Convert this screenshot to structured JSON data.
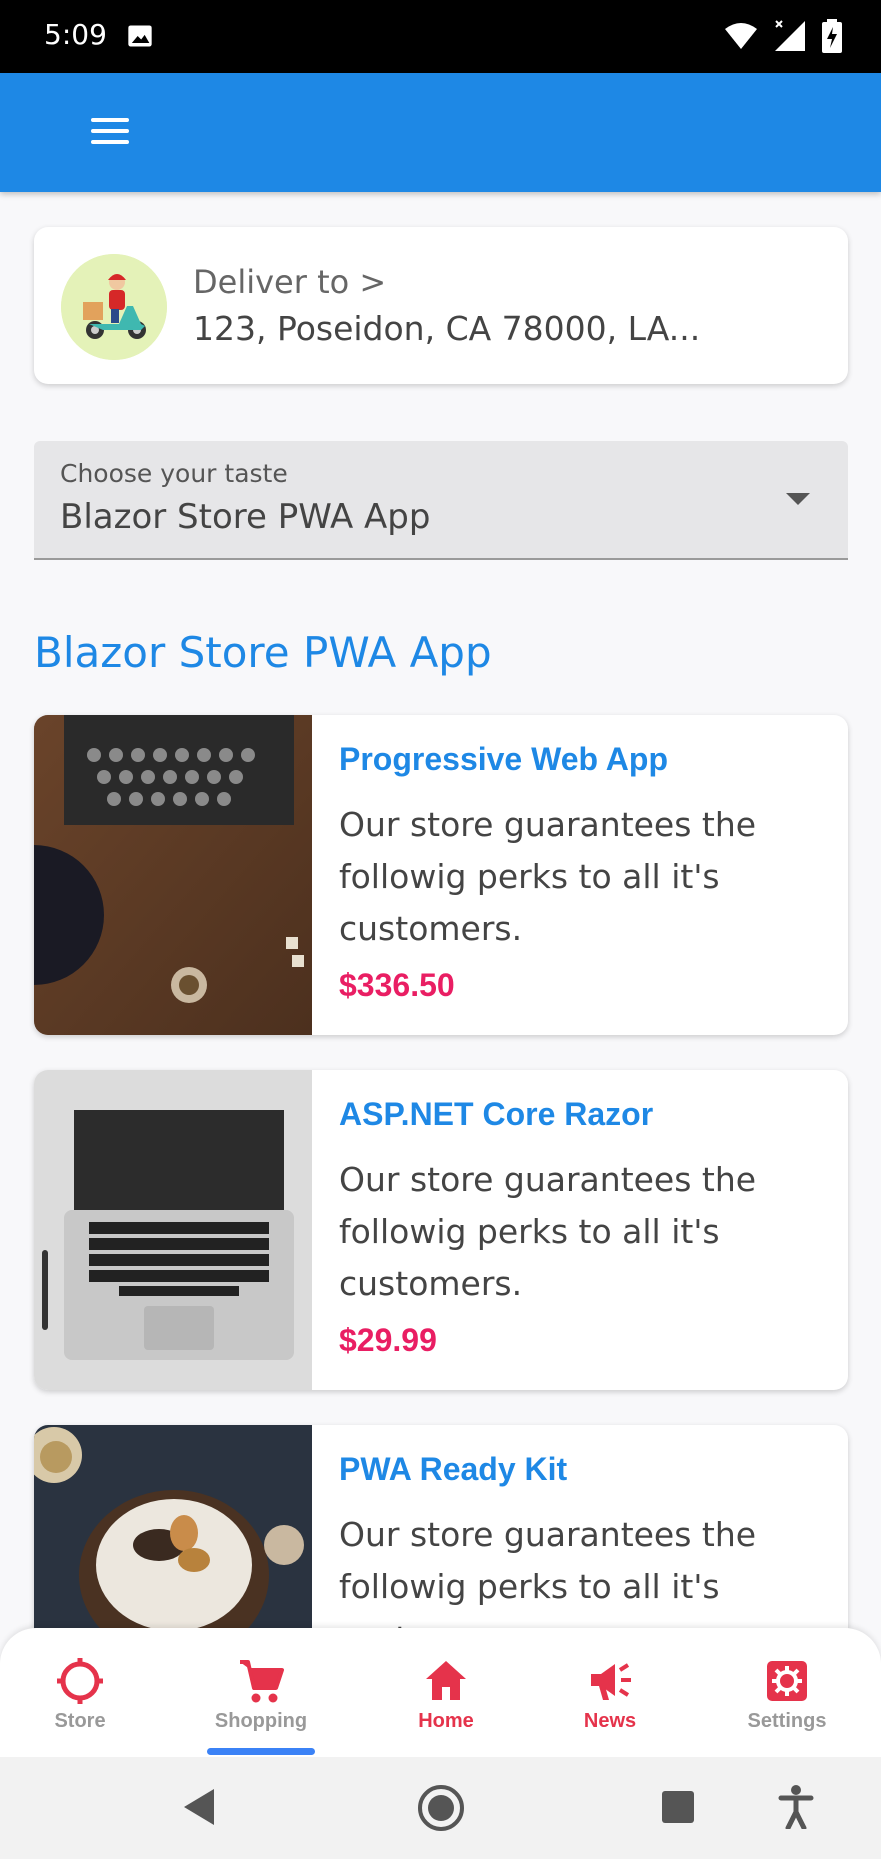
{
  "status_bar": {
    "time": "5:09",
    "icons": [
      "image-icon",
      "wifi-icon",
      "signal-icon",
      "battery-charging-icon"
    ]
  },
  "app_bar": {
    "menu_icon": "hamburger-menu-icon",
    "color": "#1e88e5"
  },
  "delivery": {
    "label": "Deliver to >",
    "address": "123, Poseidon, CA 78000, LA..."
  },
  "taste_select": {
    "label": "Choose your taste",
    "value": "Blazor Store PWA App"
  },
  "section_title": "Blazor Store PWA App",
  "products": [
    {
      "title": "Progressive Web App",
      "description": "Our store guarantees the followig perks to all it's customers.",
      "price": "$336.50",
      "image": "typewriter-photo"
    },
    {
      "title": "ASP.NET Core Razor",
      "description": "Our store guarantees the followig perks to all it's customers.",
      "price": "$29.99",
      "image": "laptop-photo"
    },
    {
      "title": "PWA Ready Kit",
      "description": "Our store guarantees the followig perks to all it's customers.",
      "price": "",
      "image": "cake-photo"
    }
  ],
  "bottom_nav": {
    "items": [
      {
        "label": "Store",
        "icon": "crosshair-icon"
      },
      {
        "label": "Shopping",
        "icon": "cart-icon",
        "active": true
      },
      {
        "label": "Home",
        "icon": "home-icon"
      },
      {
        "label": "News",
        "icon": "megaphone-icon"
      },
      {
        "label": "Settings",
        "icon": "gear-icon"
      }
    ],
    "accent": "#e5334b",
    "indicator_color": "#3b82f6"
  },
  "system_nav": {
    "icons": [
      "back-icon",
      "home-circle-icon",
      "recents-icon",
      "accessibility-icon"
    ]
  }
}
